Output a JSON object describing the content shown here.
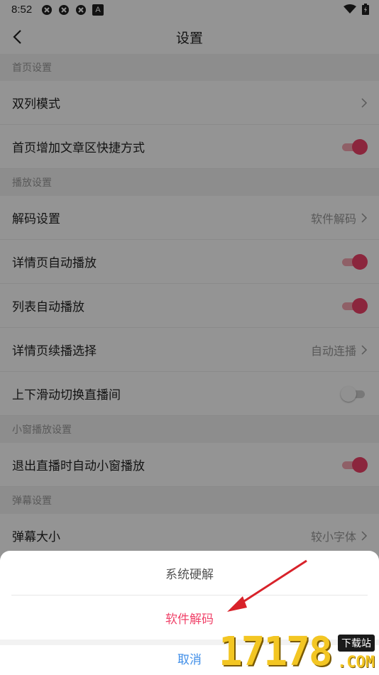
{
  "status_bar": {
    "time": "8:52",
    "notif_letter": "A"
  },
  "header": {
    "title": "设置"
  },
  "sections": [
    {
      "title": "首页设置"
    },
    {
      "title": "播放设置"
    },
    {
      "title": "小窗播放设置"
    },
    {
      "title": "弹幕设置"
    }
  ],
  "rows": [
    {
      "label": "双列模式",
      "value": ""
    },
    {
      "label": "首页增加文章区快捷方式",
      "toggle": true
    },
    {
      "label": "解码设置",
      "value": "软件解码"
    },
    {
      "label": "详情页自动播放",
      "toggle": true
    },
    {
      "label": "列表自动播放",
      "toggle": true
    },
    {
      "label": "详情页续播选择",
      "value": "自动连播"
    },
    {
      "label": "上下滑动切换直播间",
      "toggle": false
    },
    {
      "label": "退出直播时自动小窗播放",
      "toggle": true
    },
    {
      "label": "弹幕大小",
      "value": "较小字体"
    }
  ],
  "sheet": {
    "options": [
      "系统硬解",
      "软件解码"
    ],
    "cancel": "取消",
    "highlight_color": "#f0436a",
    "cancel_color": "#3f8ee8"
  },
  "watermark": {
    "number": "17178",
    "tag": "下载站",
    "suffix": ".COM"
  }
}
